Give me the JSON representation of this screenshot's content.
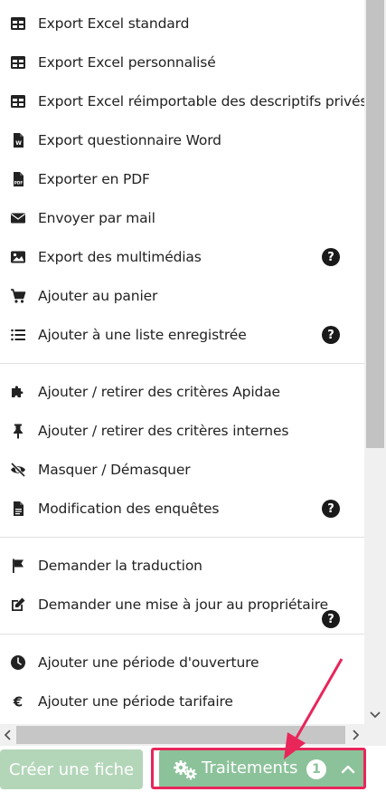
{
  "menu": {
    "items": [
      {
        "label": "Export Excel standard",
        "icon": "table-icon"
      },
      {
        "label": "Export Excel personnalisé",
        "icon": "table-icon"
      },
      {
        "label": "Export Excel réimportable des descriptifs privés",
        "icon": "table-icon"
      },
      {
        "label": "Export questionnaire Word",
        "icon": "word-file-icon"
      },
      {
        "label": "Exporter en PDF",
        "icon": "pdf-file-icon"
      },
      {
        "label": "Envoyer par mail",
        "icon": "envelope-icon"
      },
      {
        "label": "Export des multimédias",
        "icon": "image-icon",
        "help": "?"
      },
      {
        "label": "Ajouter au panier",
        "icon": "cart-icon"
      },
      {
        "label": "Ajouter à une liste enregistrée",
        "icon": "list-icon",
        "help": "?"
      },
      {
        "label": "Ajouter / retirer des critères Apidae",
        "icon": "puzzle-icon"
      },
      {
        "label": "Ajouter / retirer des critères internes",
        "icon": "pin-icon"
      },
      {
        "label": "Masquer / Démasquer",
        "icon": "eye-slash-icon"
      },
      {
        "label": "Modification des enquêtes",
        "icon": "document-icon",
        "help": "?"
      },
      {
        "label": "Demander la traduction",
        "icon": "flag-icon"
      },
      {
        "label": "Demander une mise à jour au propriétaire",
        "icon": "edit-icon",
        "help": "?"
      },
      {
        "label": "Ajouter une période d'ouverture",
        "icon": "clock-icon"
      },
      {
        "label": "Ajouter une période tarifaire",
        "icon": "euro-icon"
      }
    ]
  },
  "bottom_bar": {
    "create_button": "Créer une fiche",
    "treatments_button": "Traitements",
    "treatments_count": "1",
    "chevron_icon": "chevron-up-icon",
    "gears_icon": "gears-icon"
  },
  "annotation": {
    "highlight_color": "#e8265a"
  },
  "colors": {
    "button_green": "#8cc29a",
    "button_green_light": "#b3d6b9"
  }
}
